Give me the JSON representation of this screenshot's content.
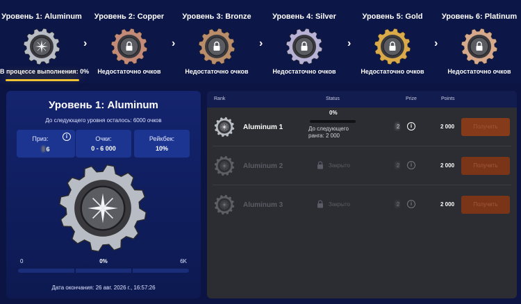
{
  "levels": [
    {
      "title": "Уровень 1: Aluminum",
      "status": "В процессе выполнения: 0%",
      "tier": "aluminum",
      "locked": false,
      "color": "#b8bcc4"
    },
    {
      "title": "Уровень 2: Copper",
      "status": "Недостаточно очков",
      "tier": "copper",
      "locked": true,
      "color": "#c48a78"
    },
    {
      "title": "Уровень 3: Bronze",
      "status": "Недостаточно очков",
      "tier": "bronze",
      "locked": true,
      "color": "#b98c6a"
    },
    {
      "title": "Уровень 4: Silver",
      "status": "Недостаточно очков",
      "tier": "silver",
      "locked": true,
      "color": "#b7b2d6"
    },
    {
      "title": "Уровень 5: Gold",
      "status": "Недостаточно очков",
      "tier": "gold",
      "locked": true,
      "color": "#d9a94a"
    },
    {
      "title": "Уровень 6: Platinum",
      "status": "Недостаточно очков",
      "tier": "platinum",
      "locked": true,
      "color": "#d7a98c"
    }
  ],
  "arrow_icon": "chevron-right-icon",
  "card": {
    "title": "Уровень 1: Aluminum",
    "subtitle": "До следующего уровня осталось: 6000 очков",
    "prize_label": "Приз:",
    "prize_value": "6",
    "points_label": "Очки:",
    "points_value": "0 - 6 000",
    "rakeback_label": "Рейкбек:",
    "rakeback_value": "10%",
    "progress_min": "0",
    "progress_pct": "0%",
    "progress_max": "6K",
    "progress_fraction": 0,
    "end_date": "Дата окончания: 26 авг. 2026 г., 16:57:26"
  },
  "table": {
    "headers": {
      "rank": "Rank",
      "status": "Status",
      "prize": "Prize",
      "points": "Points"
    },
    "rows": [
      {
        "name": "Aluminum 1",
        "active": true,
        "status_pct": "0%",
        "status_note": "До следующего ранга: 2 000",
        "prize": "2",
        "points": "2 000",
        "button": "Получить"
      },
      {
        "name": "Aluminum 2",
        "active": false,
        "lock_text": "Закрыто",
        "prize": "2",
        "points": "2 000",
        "button": "Получить"
      },
      {
        "name": "Aluminum 3",
        "active": false,
        "lock_text": "Закрыто",
        "prize": "2",
        "points": "2 000",
        "button": "Получить"
      }
    ]
  },
  "colors": {
    "accent": "#f1c232",
    "background": "#0b1442",
    "panel": "#2b2d32",
    "button": "#7a3417"
  }
}
